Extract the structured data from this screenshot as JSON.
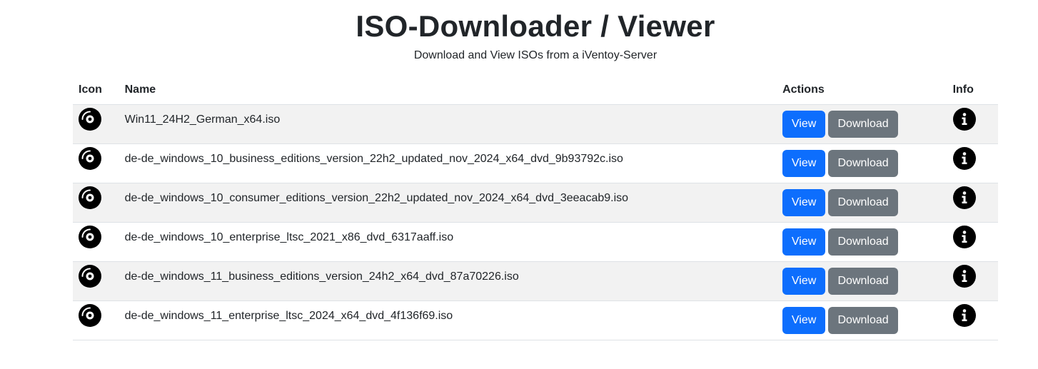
{
  "header": {
    "title": "ISO-Downloader / Viewer",
    "subtitle": "Download and View ISOs from a iVentoy-Server"
  },
  "table": {
    "columns": {
      "icon": "Icon",
      "name": "Name",
      "actions": "Actions",
      "info": "Info"
    },
    "view_label": "View",
    "download_label": "Download",
    "rows": [
      {
        "name": "Win11_24H2_German_x64.iso",
        "icon": "disc-icon"
      },
      {
        "name": "de-de_windows_10_business_editions_version_22h2_updated_nov_2024_x64_dvd_9b93792c.iso",
        "icon": "disc-icon"
      },
      {
        "name": "de-de_windows_10_consumer_editions_version_22h2_updated_nov_2024_x64_dvd_3eeacab9.iso",
        "icon": "disc-icon"
      },
      {
        "name": "de-de_windows_10_enterprise_ltsc_2021_x86_dvd_6317aaff.iso",
        "icon": "disc-icon"
      },
      {
        "name": "de-de_windows_11_business_editions_version_24h2_x64_dvd_87a70226.iso",
        "icon": "disc-icon"
      },
      {
        "name": "de-de_windows_11_enterprise_ltsc_2024_x64_dvd_4f136f69.iso",
        "icon": "disc-icon"
      }
    ]
  },
  "colors": {
    "primary": "#0d6efd",
    "secondary": "#6c757d",
    "stripe": "#f2f2f2",
    "text": "#212529"
  }
}
